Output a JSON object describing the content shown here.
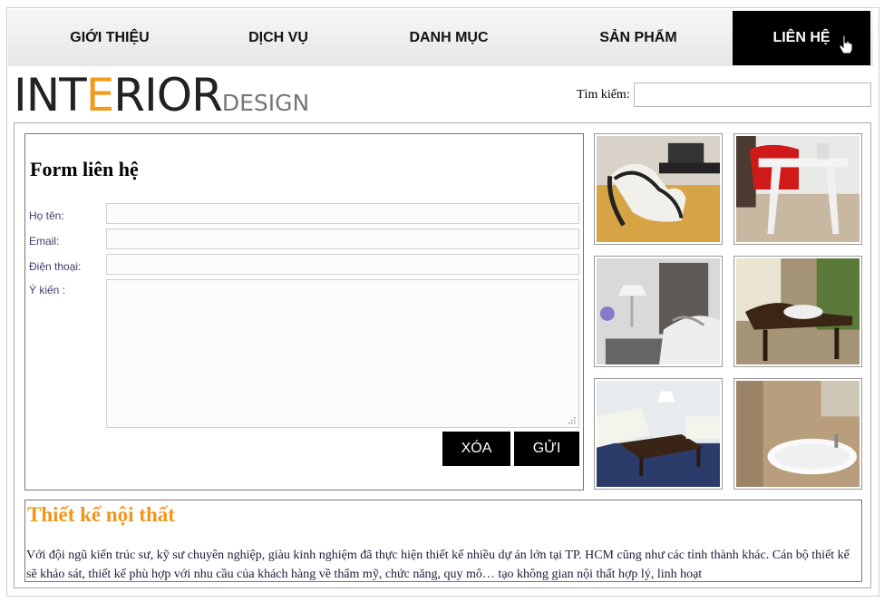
{
  "nav": {
    "items": [
      {
        "label": "GIỚI THIỆU"
      },
      {
        "label": "DỊCH VỤ"
      },
      {
        "label": "DANH MỤC"
      },
      {
        "label": "SẢN PHẨM"
      },
      {
        "label": "LIÊN HỆ"
      }
    ],
    "active_index": 4
  },
  "logo": {
    "part1": "INT",
    "highlight": "E",
    "part2": "RIOR",
    "small": "DESIGN"
  },
  "search": {
    "label": "Tìm kiếm:",
    "value": ""
  },
  "form": {
    "title": "Form liên hệ",
    "fields": [
      {
        "label": "Họ tên:",
        "value": ""
      },
      {
        "label": "Email:",
        "value": ""
      },
      {
        "label": "Điện thoại:",
        "value": ""
      }
    ],
    "comment_label": "Ý kiến :",
    "comment_value": "",
    "reset_label": "XÓA",
    "submit_label": "GỬI"
  },
  "gallery": {
    "images": [
      "white-chair-photo",
      "red-chair-table-photo",
      "bedroom-lamp-photo",
      "wooden-chair-window-photo",
      "living-room-table-photo",
      "bathtub-photo"
    ]
  },
  "about": {
    "title": "Thiết kế nội thất",
    "text": "Với đội ngũ kiến trúc sư, kỹ sư chuyên nghiệp, giàu kinh nghiệm đã thực hiện thiết kế nhiều dự án lớn tại TP. HCM cũng như các tỉnh thành khác. Cán bộ thiết kế sẽ khảo sát, thiết kế phù hợp với nhu cầu của khách hàng về thẩm mỹ, chức năng, quy mô… tạo không gian nội thất hợp lý, linh hoạt"
  },
  "colors": {
    "accent": "#f29a1a",
    "nav_active": "#000000"
  }
}
